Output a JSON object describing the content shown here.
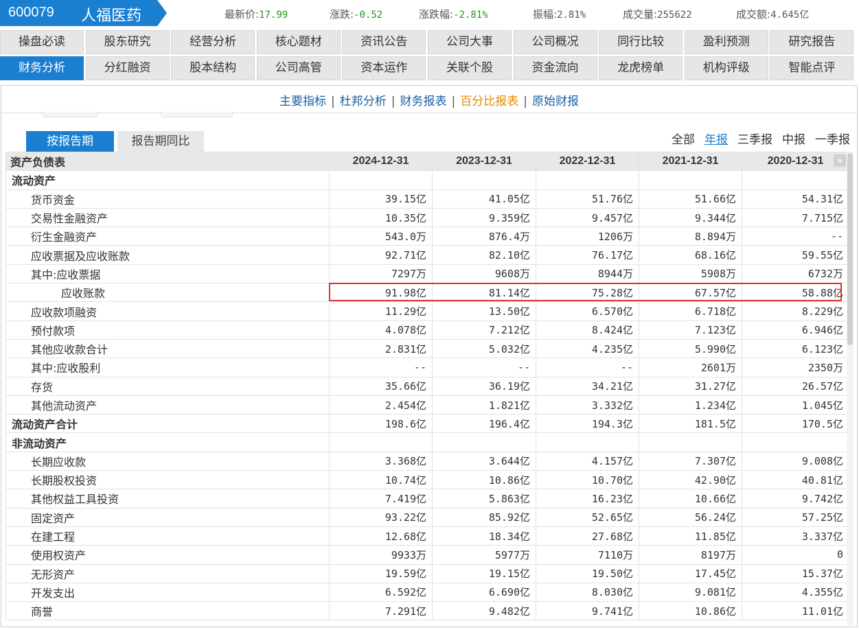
{
  "header": {
    "code": "600079",
    "name": "人福医药",
    "quotes": [
      {
        "label": "最新价:",
        "value": "17.99",
        "color": "green"
      },
      {
        "label": "涨跌:",
        "value": "-0.52",
        "color": "green"
      },
      {
        "label": "涨跌幅:",
        "value": "-2.81%",
        "color": "green"
      },
      {
        "label": "振幅:",
        "value": "2.81%",
        "color": "gray"
      },
      {
        "label": "成交量:",
        "value": "255622",
        "color": "gray"
      },
      {
        "label": "成交额:",
        "value": "4.645亿",
        "color": "gray"
      }
    ],
    "accent": "#1a7fd1"
  },
  "nav": {
    "row1": [
      "操盘必读",
      "股东研究",
      "经营分析",
      "核心题材",
      "资讯公告",
      "公司大事",
      "公司概况",
      "同行比较",
      "盈利预测",
      "研究报告"
    ],
    "row2": [
      "财务分析",
      "分红融资",
      "股本结构",
      "公司高管",
      "资本运作",
      "关联个股",
      "资金流向",
      "龙虎榜单",
      "机构评级",
      "智能点评"
    ],
    "active": "财务分析"
  },
  "subnav": {
    "items": [
      "主要指标",
      "杜邦分析",
      "财务报表",
      "百分比报表",
      "原始财报"
    ],
    "current": "百分比报表"
  },
  "tabs": {
    "on": "按报告期",
    "off": "报告期同比"
  },
  "periods": {
    "items": [
      "全部",
      "年报",
      "三季报",
      "中报",
      "一季报"
    ],
    "current": "年报"
  },
  "table": {
    "title": "资产负债表",
    "columns": [
      "2024-12-31",
      "2023-12-31",
      "2022-12-31",
      "2021-12-31",
      "2020-12-31"
    ],
    "rows": [
      {
        "name": "流动资产",
        "level": 0,
        "bold": true,
        "values": [
          "",
          "",
          "",
          "",
          ""
        ]
      },
      {
        "name": "货币资金",
        "level": 1,
        "values": [
          "39.15亿",
          "41.05亿",
          "51.76亿",
          "51.66亿",
          "54.31亿"
        ]
      },
      {
        "name": "交易性金融资产",
        "level": 1,
        "values": [
          "10.35亿",
          "9.359亿",
          "9.457亿",
          "9.344亿",
          "7.715亿"
        ]
      },
      {
        "name": "衍生金融资产",
        "level": 1,
        "values": [
          "543.0万",
          "876.4万",
          "1206万",
          "8.894万",
          "--"
        ]
      },
      {
        "name": "应收票据及应收账款",
        "level": 1,
        "values": [
          "92.71亿",
          "82.10亿",
          "76.17亿",
          "68.16亿",
          "59.55亿"
        ]
      },
      {
        "name": "其中:应收票据",
        "level": 1,
        "values": [
          "7297万",
          "9608万",
          "8944万",
          "5908万",
          "6732万"
        ]
      },
      {
        "name": "应收账款",
        "level": 2,
        "highlight": true,
        "values": [
          "91.98亿",
          "81.14亿",
          "75.28亿",
          "67.57亿",
          "58.88亿"
        ]
      },
      {
        "name": "应收款项融资",
        "level": 1,
        "values": [
          "11.29亿",
          "13.50亿",
          "6.570亿",
          "6.718亿",
          "8.229亿"
        ]
      },
      {
        "name": "预付款项",
        "level": 1,
        "values": [
          "4.078亿",
          "7.212亿",
          "8.424亿",
          "7.123亿",
          "6.946亿"
        ]
      },
      {
        "name": "其他应收款合计",
        "level": 1,
        "values": [
          "2.831亿",
          "5.032亿",
          "4.235亿",
          "5.990亿",
          "6.123亿"
        ]
      },
      {
        "name": "其中:应收股利",
        "level": 1,
        "values": [
          "--",
          "--",
          "--",
          "2601万",
          "2350万"
        ]
      },
      {
        "name": "存货",
        "level": 1,
        "values": [
          "35.66亿",
          "36.19亿",
          "34.21亿",
          "31.27亿",
          "26.57亿"
        ]
      },
      {
        "name": "其他流动资产",
        "level": 1,
        "values": [
          "2.454亿",
          "1.821亿",
          "3.332亿",
          "1.234亿",
          "1.045亿"
        ]
      },
      {
        "name": "流动资产合计",
        "level": 0,
        "bold": true,
        "values": [
          "198.6亿",
          "196.4亿",
          "194.3亿",
          "181.5亿",
          "170.5亿"
        ]
      },
      {
        "name": "非流动资产",
        "level": 0,
        "bold": true,
        "values": [
          "",
          "",
          "",
          "",
          ""
        ]
      },
      {
        "name": "长期应收款",
        "level": 1,
        "values": [
          "3.368亿",
          "3.644亿",
          "4.157亿",
          "7.307亿",
          "9.008亿"
        ]
      },
      {
        "name": "长期股权投资",
        "level": 1,
        "values": [
          "10.74亿",
          "10.86亿",
          "10.70亿",
          "42.90亿",
          "40.81亿"
        ]
      },
      {
        "name": "其他权益工具投资",
        "level": 1,
        "values": [
          "7.419亿",
          "5.863亿",
          "16.23亿",
          "10.66亿",
          "9.742亿"
        ]
      },
      {
        "name": "固定资产",
        "level": 1,
        "values": [
          "93.22亿",
          "85.92亿",
          "52.65亿",
          "56.24亿",
          "57.25亿"
        ]
      },
      {
        "name": "在建工程",
        "level": 1,
        "values": [
          "12.68亿",
          "18.34亿",
          "27.68亿",
          "11.85亿",
          "3.337亿"
        ]
      },
      {
        "name": "使用权资产",
        "level": 1,
        "values": [
          "9933万",
          "5977万",
          "7110万",
          "8197万",
          "0"
        ]
      },
      {
        "name": "无形资产",
        "level": 1,
        "values": [
          "19.59亿",
          "19.15亿",
          "19.50亿",
          "17.45亿",
          "15.37亿"
        ]
      },
      {
        "name": "开发支出",
        "level": 1,
        "values": [
          "6.592亿",
          "6.690亿",
          "8.030亿",
          "9.081亿",
          "4.355亿"
        ]
      },
      {
        "name": "商誉",
        "level": 1,
        "values": [
          "7.291亿",
          "9.482亿",
          "9.741亿",
          "10.86亿",
          "11.01亿"
        ]
      }
    ]
  }
}
